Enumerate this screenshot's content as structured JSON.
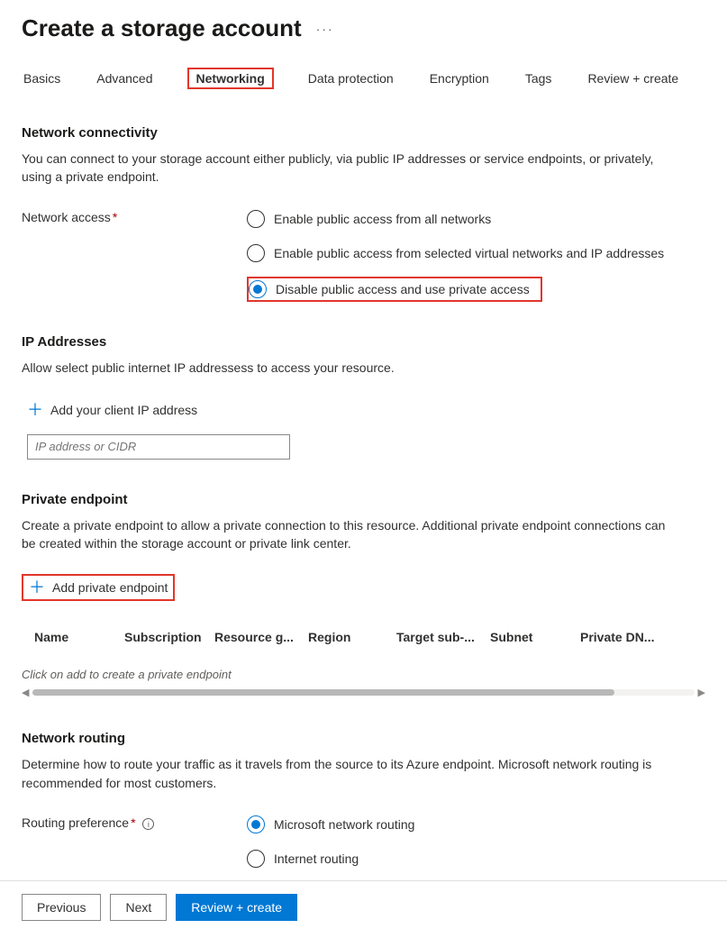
{
  "title": "Create a storage account",
  "tabs": [
    "Basics",
    "Advanced",
    "Networking",
    "Data protection",
    "Encryption",
    "Tags",
    "Review + create"
  ],
  "activeTab": "Networking",
  "networkConnectivity": {
    "heading": "Network connectivity",
    "description": "You can connect to your storage account either publicly, via public IP addresses or service endpoints, or privately, using a private endpoint.",
    "label": "Network access",
    "options": [
      "Enable public access from all networks",
      "Enable public access from selected virtual networks and IP addresses",
      "Disable public access and use private access"
    ],
    "selectedIndex": 2
  },
  "ipAddresses": {
    "heading": "IP Addresses",
    "description": "Allow select public internet IP addressess to access your resource.",
    "addAction": "Add your client IP address",
    "placeholder": "IP address or CIDR"
  },
  "privateEndpoint": {
    "heading": "Private endpoint",
    "description": "Create a private endpoint to allow a private connection to this resource. Additional private endpoint connections can be created within the storage account or private link center.",
    "addAction": "Add private endpoint",
    "columns": [
      "Name",
      "Subscription",
      "Resource g...",
      "Region",
      "Target sub-...",
      "Subnet",
      "Private DN..."
    ],
    "emptyText": "Click on add to create a private endpoint"
  },
  "networkRouting": {
    "heading": "Network routing",
    "description": "Determine how to route your traffic as it travels from the source to its Azure endpoint. Microsoft network routing is recommended for most customers.",
    "label": "Routing preference",
    "options": [
      "Microsoft network routing",
      "Internet routing"
    ],
    "selectedIndex": 0
  },
  "footer": {
    "previous": "Previous",
    "next": "Next",
    "review": "Review + create"
  }
}
